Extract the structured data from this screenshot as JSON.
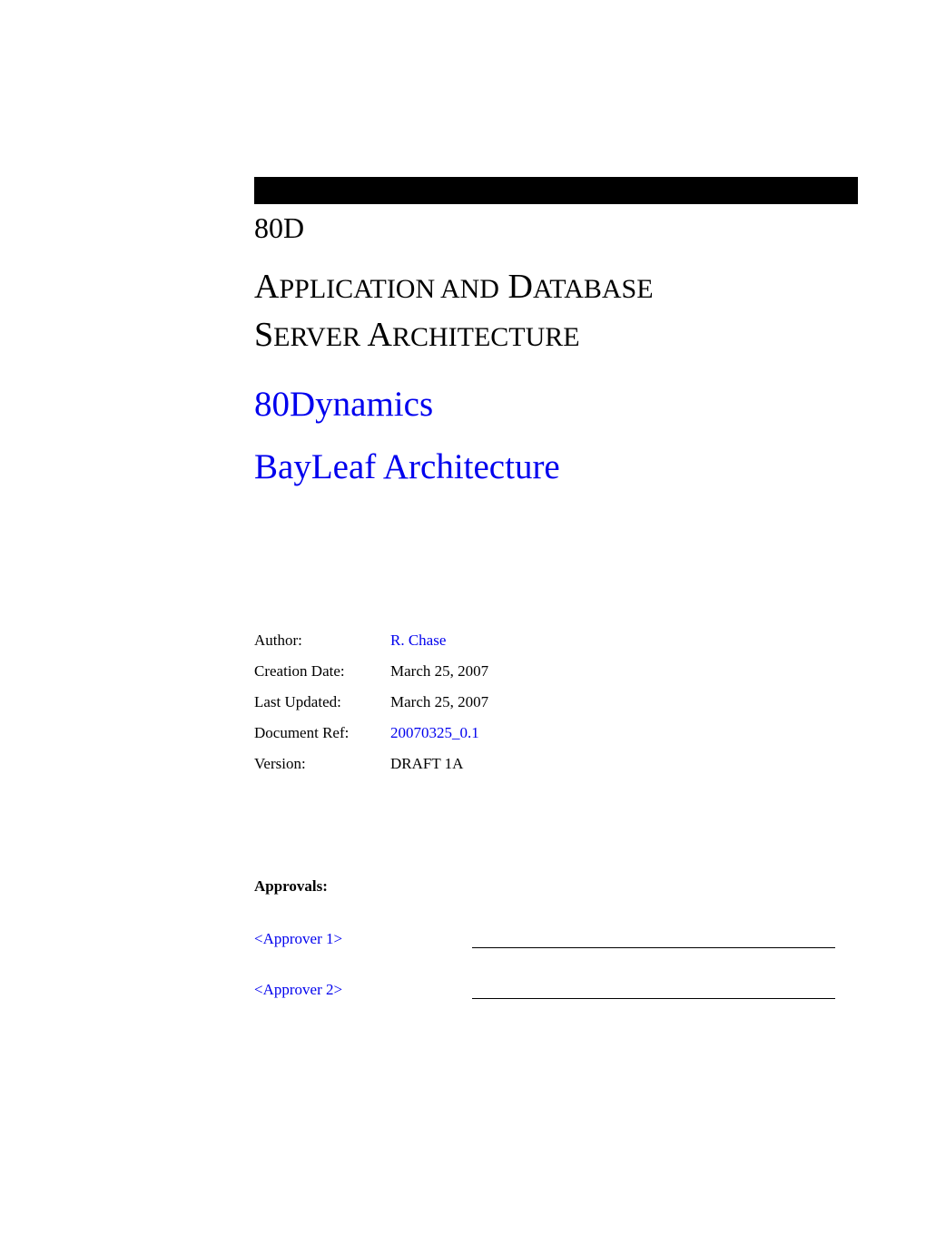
{
  "header": {
    "short_code": "80D"
  },
  "title": {
    "line1_caps": "A",
    "line1_rest": "PPLICATION AND",
    "line1b_caps": "D",
    "line1b_rest": "ATABASE",
    "line2_caps": "S",
    "line2_rest": "ERVER",
    "line2b_caps": "A",
    "line2b_rest": "RCHITECTURE"
  },
  "subtitle1": "80Dynamics",
  "subtitle2": "BayLeaf Architecture",
  "meta": {
    "author_label": "Author:",
    "author_value": "R. Chase",
    "creation_label": "Creation Date:",
    "creation_value": "March 25, 2007",
    "updated_label": "Last Updated:",
    "updated_value": "March 25, 2007",
    "docref_label": "Document Ref:",
    "docref_value": "20070325_0.1",
    "version_label": "Version:",
    "version_value": "DRAFT 1A"
  },
  "approvals": {
    "heading": "Approvals:",
    "approver1": "<Approver 1>",
    "approver2": "<Approver 2>"
  }
}
